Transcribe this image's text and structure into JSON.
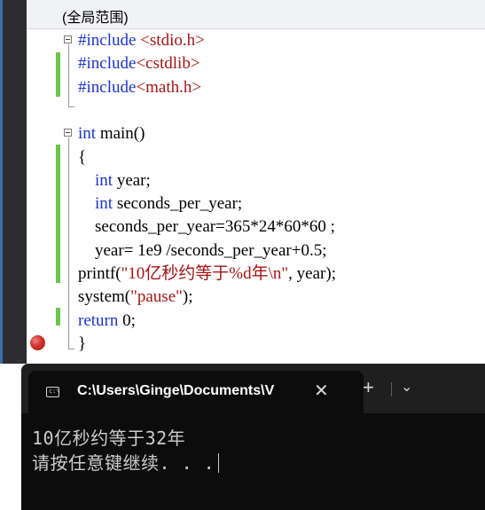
{
  "editor": {
    "scope_label": "(全局范围)",
    "lines": [
      {
        "segments": [
          {
            "t": "#include ",
            "c": "kw"
          },
          {
            "t": "<stdio.h>",
            "c": "str"
          }
        ]
      },
      {
        "segments": [
          {
            "t": "#include",
            "c": "kw"
          },
          {
            "t": "<cstdlib>",
            "c": "str"
          }
        ]
      },
      {
        "segments": [
          {
            "t": "#include",
            "c": "kw"
          },
          {
            "t": "<math.h>",
            "c": "str"
          }
        ]
      },
      {
        "segments": []
      },
      {
        "segments": [
          {
            "t": "int",
            "c": "kw"
          },
          {
            "t": " main()",
            "c": ""
          }
        ]
      },
      {
        "segments": [
          {
            "t": "{",
            "c": ""
          }
        ]
      },
      {
        "segments": [
          {
            "t": "    int",
            "c": "kw"
          },
          {
            "t": " year;",
            "c": ""
          }
        ]
      },
      {
        "segments": [
          {
            "t": "    int",
            "c": "kw"
          },
          {
            "t": " seconds_per_year;",
            "c": ""
          }
        ]
      },
      {
        "segments": [
          {
            "t": "    seconds_per_year=365*24*60*60 ;",
            "c": ""
          }
        ]
      },
      {
        "segments": [
          {
            "t": "    year= 1e9 /seconds_per_year+0.5;",
            "c": ""
          }
        ]
      },
      {
        "segments": [
          {
            "t": "printf(",
            "c": ""
          },
          {
            "t": "\"10亿秒约等于%d年\\n\"",
            "c": "str"
          },
          {
            "t": ", year);",
            "c": ""
          }
        ]
      },
      {
        "segments": [
          {
            "t": "system(",
            "c": ""
          },
          {
            "t": "\"pause\"",
            "c": "str"
          },
          {
            "t": ");",
            "c": ""
          }
        ]
      },
      {
        "segments": [
          {
            "t": "return",
            "c": "kw"
          },
          {
            "t": " 0;",
            "c": ""
          }
        ]
      },
      {
        "segments": [
          {
            "t": "}",
            "c": ""
          }
        ]
      }
    ]
  },
  "terminal": {
    "tab_title": "C:\\Users\\Ginge\\Documents\\V",
    "close_glyph": "✕",
    "new_tab_glyph": "+",
    "dropdown_glyph": "⌄",
    "icon_text": "c:\\",
    "output_lines": [
      "10亿秒约等于32年",
      "请按任意键继续. . ."
    ]
  },
  "colors": {
    "keyword": "#1f34c9",
    "string": "#a31515",
    "change_bar": "#6dc44b",
    "terminal_bg": "#0c0c0c"
  }
}
